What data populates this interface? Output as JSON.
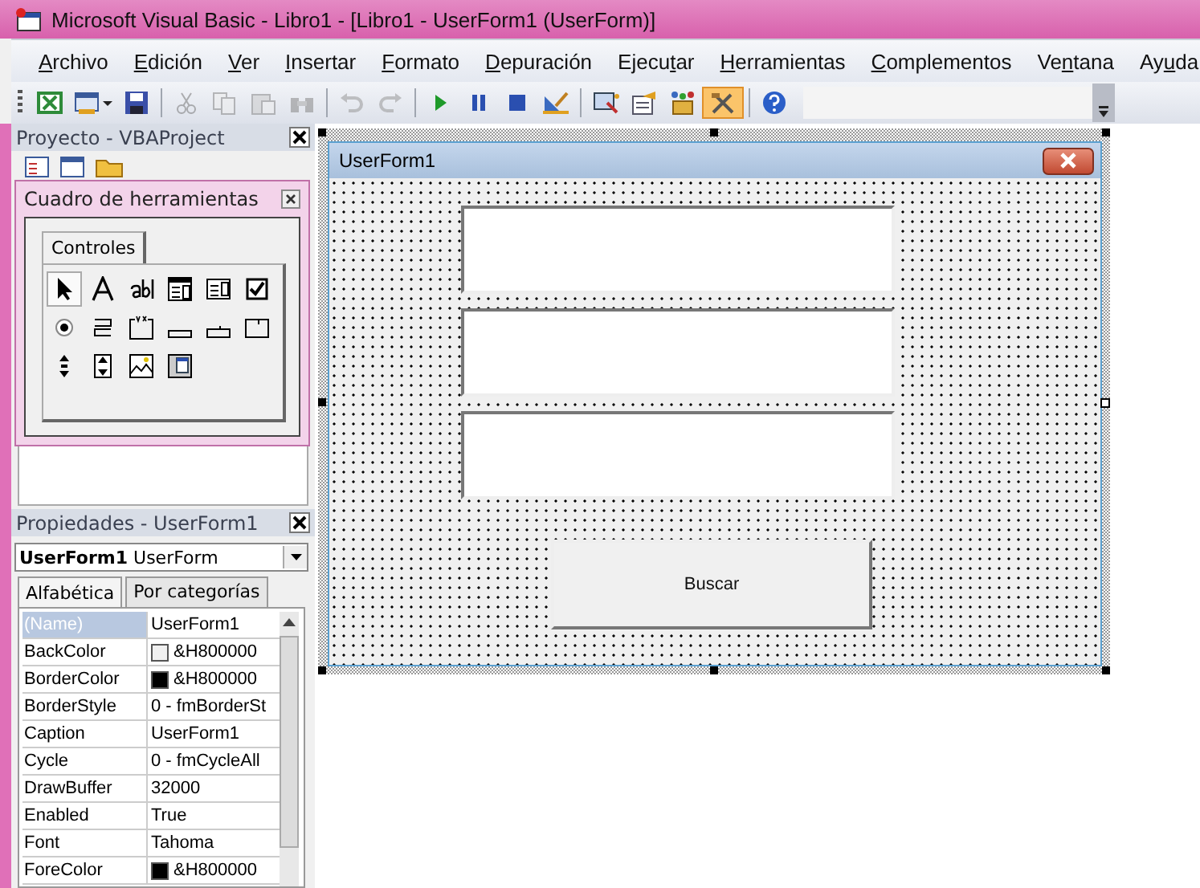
{
  "window": {
    "title": "Microsoft Visual Basic - Libro1 - [Libro1 - UserForm1 (UserForm)]"
  },
  "menu": [
    {
      "key": "A",
      "post": "rchivo"
    },
    {
      "key": "E",
      "post": "dición"
    },
    {
      "key": "V",
      "post": "er"
    },
    {
      "key": "I",
      "post": "nsertar"
    },
    {
      "key": "F",
      "post": "ormato"
    },
    {
      "key": "D",
      "post": "epuración"
    },
    {
      "pre": "Ejecu",
      "key": "t",
      "post": "ar"
    },
    {
      "key": "H",
      "post": "erramientas"
    },
    {
      "key": "C",
      "post": "omplementos"
    },
    {
      "pre": "Ve",
      "key": "n",
      "post": "tana"
    },
    {
      "pre": "Ay",
      "key": "u",
      "post": "da"
    }
  ],
  "toolbar": [
    {
      "kind": "excel",
      "disabled": false,
      "selected": false
    },
    {
      "kind": "insert-form",
      "disabled": false,
      "selected": false
    },
    {
      "kind": "save",
      "disabled": false,
      "selected": false
    },
    {
      "kind": "sep"
    },
    {
      "kind": "cut",
      "disabled": true,
      "selected": false
    },
    {
      "kind": "copy",
      "disabled": true,
      "selected": false
    },
    {
      "kind": "paste",
      "disabled": true,
      "selected": false
    },
    {
      "kind": "find",
      "disabled": true,
      "selected": false
    },
    {
      "kind": "sep"
    },
    {
      "kind": "undo",
      "disabled": true,
      "selected": false
    },
    {
      "kind": "redo",
      "disabled": true,
      "selected": false
    },
    {
      "kind": "sep"
    },
    {
      "kind": "run",
      "disabled": false,
      "selected": false
    },
    {
      "kind": "pause",
      "disabled": false,
      "selected": false
    },
    {
      "kind": "stop",
      "disabled": false,
      "selected": false
    },
    {
      "kind": "design",
      "disabled": false,
      "selected": false
    },
    {
      "kind": "sep"
    },
    {
      "kind": "project",
      "disabled": false,
      "selected": false
    },
    {
      "kind": "properties",
      "disabled": false,
      "selected": false
    },
    {
      "kind": "browser",
      "disabled": false,
      "selected": false
    },
    {
      "kind": "toolbox",
      "disabled": false,
      "selected": true
    },
    {
      "kind": "sep"
    },
    {
      "kind": "help",
      "disabled": false,
      "selected": false
    }
  ],
  "project": {
    "title": "Proyecto - VBAProject"
  },
  "toolbox": {
    "title": "Cuadro de herramientas",
    "tabs": [
      {
        "label": "Controles",
        "selected": true
      }
    ],
    "controls": [
      {
        "kind": "pointer",
        "selected": true
      },
      {
        "kind": "label",
        "selected": false
      },
      {
        "kind": "textbox",
        "selected": false
      },
      {
        "kind": "combo",
        "selected": false
      },
      {
        "kind": "list",
        "selected": false
      },
      {
        "kind": "check",
        "selected": false
      },
      {
        "kind": "option",
        "selected": false
      },
      {
        "kind": "toggle",
        "selected": false
      },
      {
        "kind": "frame",
        "selected": false
      },
      {
        "kind": "button",
        "selected": false
      },
      {
        "kind": "tabstrip",
        "selected": false
      },
      {
        "kind": "multipage",
        "selected": false
      },
      {
        "kind": "scroll",
        "selected": false
      },
      {
        "kind": "spin",
        "selected": false
      },
      {
        "kind": "image",
        "selected": false
      },
      {
        "kind": "refedit",
        "selected": false
      }
    ]
  },
  "properties": {
    "title": "Propiedades - UserForm1",
    "object": {
      "name": "UserForm1",
      "type": "UserForm"
    },
    "tabs": [
      {
        "label": "Alfabética",
        "selected": true
      },
      {
        "label": "Por categorías",
        "selected": false
      }
    ],
    "rows": [
      {
        "name": "(Name)",
        "value": "UserForm1",
        "selected": true
      },
      {
        "name": "BackColor",
        "value": "&H800000",
        "color": "#f0f0f0",
        "selected": false
      },
      {
        "name": "BorderColor",
        "value": "&H800000",
        "color": "#000000",
        "selected": false
      },
      {
        "name": "BorderStyle",
        "value": "0 - fmBorderSt",
        "selected": false
      },
      {
        "name": "Caption",
        "value": "UserForm1",
        "selected": false
      },
      {
        "name": "Cycle",
        "value": "0 - fmCycleAll",
        "selected": false
      },
      {
        "name": "DrawBuffer",
        "value": "32000",
        "selected": false
      },
      {
        "name": "Enabled",
        "value": "True",
        "selected": false
      },
      {
        "name": "Font",
        "value": "Tahoma",
        "selected": false
      },
      {
        "name": "ForeColor",
        "value": "&H800000",
        "color": "#000000",
        "selected": false
      }
    ]
  },
  "form": {
    "title": "UserForm1",
    "textboxes": [
      {
        "kind": "textbox"
      },
      {
        "kind": "textbox"
      },
      {
        "kind": "textbox"
      }
    ],
    "button": "Buscar"
  }
}
